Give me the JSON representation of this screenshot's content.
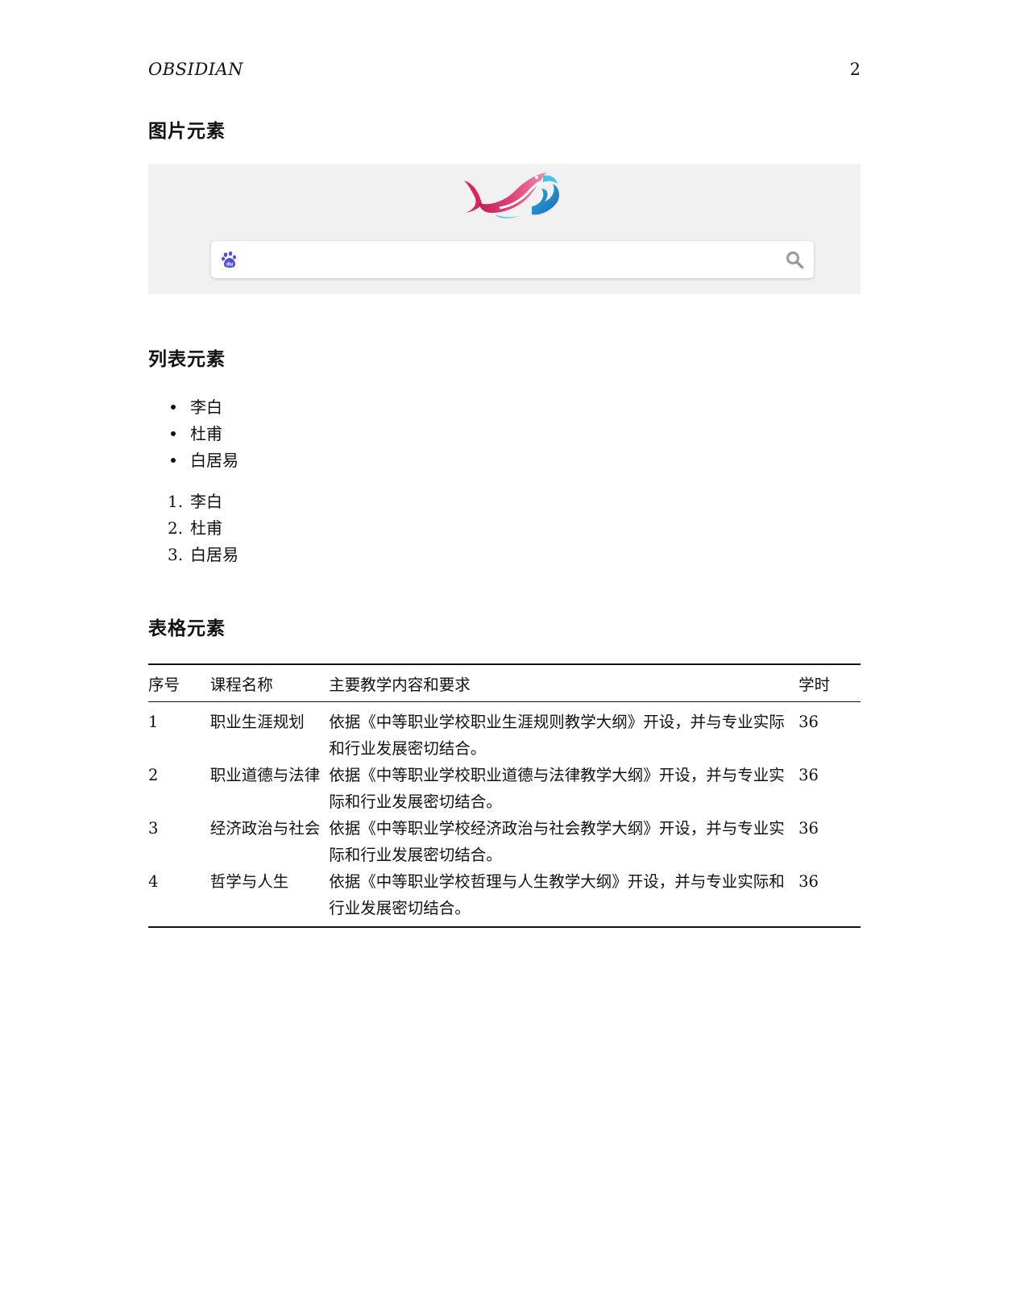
{
  "header": {
    "title": "OBSIDIAN",
    "page_number": "2"
  },
  "sections": {
    "image": "图片元素",
    "list": "列表元素",
    "table": "表格元素"
  },
  "icons": {
    "logo": "koi-fish-logo",
    "search_left": "baidu-paw-icon",
    "search_right": "magnifier-icon"
  },
  "colors": {
    "figure_background": "#f1f1f1",
    "paw": "#4e4ee0",
    "magnifier": "#9a9a9a"
  },
  "bullet_list": [
    "李白",
    "杜甫",
    "白居易"
  ],
  "ordered_list": [
    {
      "num": "1.",
      "text": "李白"
    },
    {
      "num": "2.",
      "text": "杜甫"
    },
    {
      "num": "3.",
      "text": "白居易"
    }
  ],
  "table": {
    "headers": [
      "序号",
      "课程名称",
      "主要教学内容和要求",
      "学时"
    ],
    "rows": [
      {
        "idx": "1",
        "name": "职业生涯规划",
        "content": "依据《中等职业学校职业生涯规则教学大纲》开设，并与专业实际和行业发展密切结合。",
        "hours": "36"
      },
      {
        "idx": "2",
        "name": "职业道德与法律",
        "content": "依据《中等职业学校职业道德与法律教学大纲》开设，并与专业实际和行业发展密切结合。",
        "hours": "36"
      },
      {
        "idx": "3",
        "name": "经济政治与社会",
        "content": "依据《中等职业学校经济政治与社会教学大纲》开设，并与专业实际和行业发展密切结合。",
        "hours": "36"
      },
      {
        "idx": "4",
        "name": "哲学与人生",
        "content": "依据《中等职业学校哲理与人生教学大纲》开设，并与专业实际和行业发展密切结合。",
        "hours": "36"
      }
    ]
  }
}
